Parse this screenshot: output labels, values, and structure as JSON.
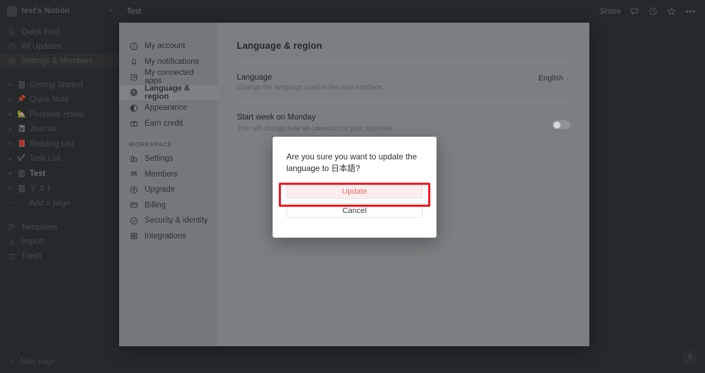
{
  "workspace": {
    "name": "test's Notion",
    "caret_icon": "chevron-updown-icon",
    "collapse_icon": "collapse-sidebar-icon",
    "nav": [
      {
        "label": "Quick Find",
        "icon": "search-icon"
      },
      {
        "label": "All Updates",
        "icon": "clock-icon"
      },
      {
        "label": "Settings & Members",
        "icon": "gear-icon",
        "active": true
      }
    ],
    "pages": [
      {
        "label": "Getting Started",
        "emoji": "doc"
      },
      {
        "label": "Quick Note",
        "emoji": "📌"
      },
      {
        "label": "Personal Home",
        "emoji": "🏡"
      },
      {
        "label": "Journal",
        "emoji": "📓"
      },
      {
        "label": "Reading List",
        "emoji": "📕"
      },
      {
        "label": "Task List",
        "emoji": "✔️"
      },
      {
        "label": "Test",
        "emoji": "doc",
        "bold": true
      },
      {
        "label": "テスト",
        "emoji": "doc"
      }
    ],
    "add_page": {
      "label": "Add a page",
      "icon": "plus-icon"
    },
    "utilities": [
      {
        "label": "Templates",
        "icon": "templates-icon"
      },
      {
        "label": "Import",
        "icon": "import-icon"
      },
      {
        "label": "Trash",
        "icon": "trash-icon"
      }
    ],
    "new_page": {
      "label": "New page",
      "icon": "plus-icon"
    }
  },
  "topbar": {
    "title": "Test",
    "share_label": "Share",
    "icons": [
      "comment-icon",
      "clock-icon",
      "star-icon",
      "more-horizontal-icon"
    ]
  },
  "help": {
    "label": "?"
  },
  "settings": {
    "account_items": [
      {
        "label": "My account",
        "icon": "person-circle-icon"
      },
      {
        "label": "My notifications",
        "icon": "bell-icon"
      },
      {
        "label": "My connected apps",
        "icon": "connected-apps-icon"
      },
      {
        "label": "Language & region",
        "icon": "globe-icon",
        "active": true
      },
      {
        "label": "Appearance",
        "icon": "appearance-icon"
      },
      {
        "label": "Earn credit",
        "icon": "gift-icon"
      }
    ],
    "workspace_section": "WORKSPACE",
    "workspace_items": [
      {
        "label": "Settings",
        "icon": "building-icon"
      },
      {
        "label": "Members",
        "icon": "members-icon"
      },
      {
        "label": "Upgrade",
        "icon": "upgrade-icon"
      },
      {
        "label": "Billing",
        "icon": "billing-icon"
      },
      {
        "label": "Security & identity",
        "icon": "shield-check-icon"
      },
      {
        "label": "Integrations",
        "icon": "grid-icon"
      }
    ],
    "page_title": "Language & region",
    "fields": [
      {
        "label": "Language",
        "desc": "Change the language used in the user interface.",
        "value": "English",
        "control": "dropdown"
      },
      {
        "label": "Start week on Monday",
        "desc": "This will change how all calendars in your app look.",
        "control": "toggle",
        "toggle_on": false
      }
    ]
  },
  "dialog": {
    "message": "Are you sure you want to update the language to 日本語?",
    "update_label": "Update",
    "cancel_label": "Cancel",
    "highlight_color": "#fc0d1b",
    "update_text_color": "#eb6b6b",
    "update_bg_color": "#fdeeee"
  }
}
